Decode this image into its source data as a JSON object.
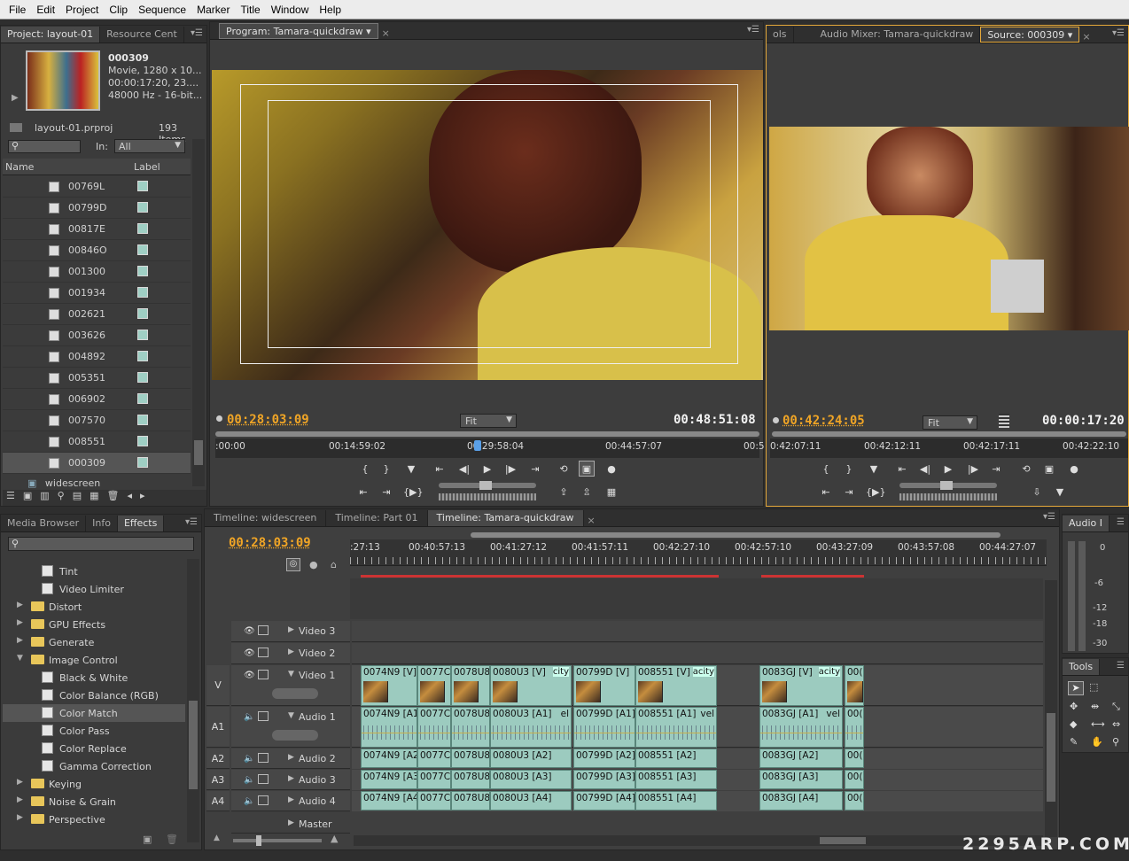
{
  "menu": [
    "File",
    "Edit",
    "Project",
    "Clip",
    "Sequence",
    "Marker",
    "Title",
    "Window",
    "Help"
  ],
  "project": {
    "tabs": [
      "Project: layout-01",
      "Resource Cent"
    ],
    "clip_name": "000309",
    "clip_info": [
      "Movie, 1280 x 10...",
      "00:00:17:20, 23....",
      "48000 Hz - 16-bit..."
    ],
    "file": "layout-01.prproj",
    "count": "193 Items",
    "in_label": "In:",
    "in_value": "All",
    "col_name": "Name",
    "col_label": "Label",
    "items": [
      "00769L",
      "00799D",
      "00817E",
      "00846O",
      "001300",
      "001934",
      "002621",
      "003626",
      "004892",
      "005351",
      "006902",
      "007570",
      "008551",
      "000309"
    ],
    "bin": "widescreen"
  },
  "program": {
    "tab": "Program: Tamara-quickdraw",
    "tc_in": "00:28:03:09",
    "fit": "Fit",
    "tc_dur": "00:48:51:08",
    "ruler": [
      ":00:00",
      "00:14:59:02",
      "00:29:58:04",
      "00:44:57:07",
      "00:5"
    ]
  },
  "source": {
    "tabs": [
      "ols",
      "Audio Mixer: Tamara-quickdraw",
      "Source: 000309"
    ],
    "tc_in": "00:42:24:05",
    "fit": "Fit",
    "tc_dur": "00:00:17:20",
    "ruler": [
      "0:42:07:11",
      "00:42:12:11",
      "00:42:17:11",
      "00:42:22:10"
    ]
  },
  "effects": {
    "tabs": [
      "Media Browser",
      "Info",
      "Effects"
    ],
    "items": [
      {
        "label": "Tint",
        "type": "fx"
      },
      {
        "label": "Video Limiter",
        "type": "fx"
      },
      {
        "label": "Distort",
        "type": "folder",
        "open": false
      },
      {
        "label": "GPU Effects",
        "type": "folder",
        "open": false
      },
      {
        "label": "Generate",
        "type": "folder",
        "open": false
      },
      {
        "label": "Image Control",
        "type": "folder",
        "open": true
      },
      {
        "label": "Black & White",
        "type": "fx"
      },
      {
        "label": "Color Balance (RGB)",
        "type": "fx"
      },
      {
        "label": "Color Match",
        "type": "fx"
      },
      {
        "label": "Color Pass",
        "type": "fx"
      },
      {
        "label": "Color Replace",
        "type": "fx"
      },
      {
        "label": "Gamma Correction",
        "type": "fx"
      },
      {
        "label": "Keying",
        "type": "folder",
        "open": false
      },
      {
        "label": "Noise & Grain",
        "type": "folder",
        "open": false
      },
      {
        "label": "Perspective",
        "type": "folder",
        "open": false
      }
    ]
  },
  "timeline": {
    "tabs": [
      "Timeline: widescreen",
      "Timeline: Part 01",
      "Timeline: Tamara-quickdraw"
    ],
    "tc": "00:28:03:09",
    "ruler": [
      ":27:13",
      "00:40:57:13",
      "00:41:27:12",
      "00:41:57:11",
      "00:42:27:10",
      "00:42:57:10",
      "00:43:27:09",
      "00:43:57:08",
      "00:44:27:07"
    ],
    "tracks": {
      "v3": "Video 3",
      "v2": "Video 2",
      "v1": "Video 1",
      "a1": "Audio 1",
      "a2": "Audio 2",
      "a3": "Audio 3",
      "a4": "Audio 4",
      "master": "Master"
    },
    "targets": {
      "v": "V",
      "a1": "A1",
      "a2": "A2",
      "a3": "A3",
      "a4": "A4"
    },
    "v1_clips": [
      "0074N9 [V]",
      "0077Cf",
      "0078U8",
      "0080U3 [V]",
      "city",
      "00799D [V]",
      "008551 [V]",
      "acity",
      "0083GJ [V]",
      "acity",
      "00("
    ],
    "a1_clips": [
      "0074N9 [A1",
      "0077Cf",
      "0078U8",
      "0080U3 [A1]",
      "el",
      "00799D [A1]",
      "008551 [A1]",
      "vel",
      "0083GJ [A1]",
      "vel",
      "00("
    ],
    "a2_clips": [
      "0074N9 [A2",
      "0077Cf",
      "0078U8",
      "0080U3 [A2]",
      "00799D [A2]",
      "008551 [A2]",
      "0083GJ [A2]",
      "00("
    ],
    "a3_clips": [
      "0074N9 [A3",
      "0077Cf",
      "0078U8",
      "0080U3 [A3]",
      "00799D [A3]",
      "008551 [A3]",
      "0083GJ [A3]",
      "00("
    ],
    "a4_clips": [
      "0074N9 [A4",
      "0077Cf",
      "0078U8",
      "0080U3 [A4]",
      "00799D [A4]",
      "008551 [A4]",
      "0083GJ [A4]",
      "00("
    ]
  },
  "audio_meter": {
    "tab": "Audio I",
    "scale": [
      "0",
      "-6",
      "-12",
      "-18",
      "-30"
    ]
  },
  "tools": {
    "tab": "Tools"
  },
  "watermark": "2295ARP.COM"
}
